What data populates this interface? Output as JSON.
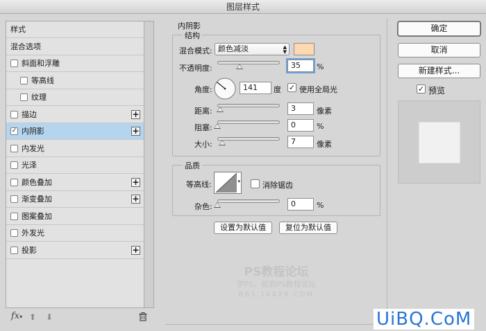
{
  "window": {
    "title": "图层样式"
  },
  "style_list": {
    "items": [
      {
        "label": "样式",
        "checkbox": false,
        "checked": false,
        "plus": false,
        "selected": false,
        "indent": 0
      },
      {
        "label": "混合选项",
        "checkbox": false,
        "checked": false,
        "plus": false,
        "selected": false,
        "indent": 0
      },
      {
        "label": "斜面和浮雕",
        "checkbox": true,
        "checked": false,
        "plus": false,
        "selected": false,
        "indent": 0
      },
      {
        "label": "等高线",
        "checkbox": true,
        "checked": false,
        "plus": false,
        "selected": false,
        "indent": 1
      },
      {
        "label": "纹理",
        "checkbox": true,
        "checked": false,
        "plus": false,
        "selected": false,
        "indent": 1
      },
      {
        "label": "描边",
        "checkbox": true,
        "checked": false,
        "plus": true,
        "selected": false,
        "indent": 0
      },
      {
        "label": "内阴影",
        "checkbox": true,
        "checked": true,
        "plus": true,
        "selected": true,
        "indent": 0
      },
      {
        "label": "内发光",
        "checkbox": true,
        "checked": false,
        "plus": false,
        "selected": false,
        "indent": 0
      },
      {
        "label": "光泽",
        "checkbox": true,
        "checked": false,
        "plus": false,
        "selected": false,
        "indent": 0
      },
      {
        "label": "颜色叠加",
        "checkbox": true,
        "checked": false,
        "plus": true,
        "selected": false,
        "indent": 0
      },
      {
        "label": "渐变叠加",
        "checkbox": true,
        "checked": false,
        "plus": true,
        "selected": false,
        "indent": 0
      },
      {
        "label": "图案叠加",
        "checkbox": true,
        "checked": false,
        "plus": false,
        "selected": false,
        "indent": 0
      },
      {
        "label": "外发光",
        "checkbox": true,
        "checked": false,
        "plus": false,
        "selected": false,
        "indent": 0
      },
      {
        "label": "投影",
        "checkbox": true,
        "checked": false,
        "plus": true,
        "selected": false,
        "indent": 0
      }
    ],
    "footer": {
      "fx_label": "fx"
    }
  },
  "inner_shadow": {
    "section_title": "内阴影",
    "structure": {
      "title": "结构",
      "blend_mode_label": "混合模式:",
      "blend_mode_value": "颜色减淡",
      "swatch_color": "#fdd8b0",
      "opacity_label": "不透明度:",
      "opacity_value": "35",
      "opacity_level": 35,
      "percent": "%",
      "angle_label": "角度:",
      "angle_value": "141",
      "angle_unit": "度",
      "global_light_label": "使用全局光",
      "global_light_checked": true,
      "distance_label": "距离:",
      "distance_value": "3",
      "distance_unit": "像素",
      "choke_label": "阻塞:",
      "choke_value": "0",
      "size_label": "大小:",
      "size_value": "7",
      "size_unit": "像素"
    },
    "quality": {
      "title": "品质",
      "contour_label": "等高线:",
      "anti_alias_label": "消除锯齿",
      "anti_alias_checked": false,
      "noise_label": "杂色:",
      "noise_value": "0"
    },
    "set_default_label": "设置为默认值",
    "reset_default_label": "复位为默认值"
  },
  "right_panel": {
    "ok_label": "确定",
    "cancel_label": "取消",
    "new_style_label": "新建样式...",
    "preview_label": "预览",
    "preview_checked": true
  },
  "watermark": {
    "line1": "PS教程论坛",
    "line2": "学PS，就到PS教程论坛",
    "line3": "BBS.16XX8.COM",
    "corner": "UiBQ.CoM"
  },
  "icons": [
    "fx-icon",
    "move-up-icon",
    "move-down-icon",
    "trash-icon",
    "dropdown-arrows-icon",
    "angle-dial-icon",
    "contour-curve-icon",
    "plus-icon",
    "checkbox-icon"
  ]
}
